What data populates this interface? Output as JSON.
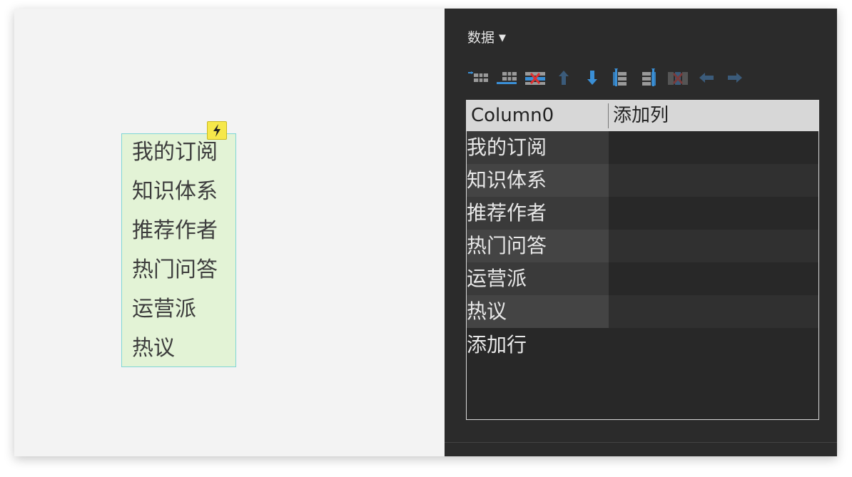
{
  "canvas": {
    "list_items": [
      "我的订阅",
      "知识体系",
      "推荐作者",
      "热门问答",
      "运营派",
      "热议"
    ],
    "badge_icon": "lightning-icon"
  },
  "panel": {
    "title": "数据",
    "title_arrow": "▼",
    "toolbar": [
      {
        "name": "insert-row-above-icon"
      },
      {
        "name": "insert-row-below-icon"
      },
      {
        "name": "delete-row-icon"
      },
      {
        "name": "move-up-icon"
      },
      {
        "name": "move-down-icon"
      },
      {
        "name": "insert-column-left-icon"
      },
      {
        "name": "insert-column-right-icon"
      },
      {
        "name": "delete-column-icon"
      },
      {
        "name": "move-left-icon"
      },
      {
        "name": "move-right-icon"
      }
    ],
    "grid": {
      "columns": [
        "Column0",
        "添加列"
      ],
      "rows": [
        "我的订阅",
        "知识体系",
        "推荐作者",
        "热门问答",
        "运营派",
        "热议"
      ],
      "add_row_label": "添加行"
    }
  },
  "colors": {
    "accent_blue": "#3a8fd6",
    "delete_red": "#e03030",
    "widget_fill": "#e3f3d6",
    "widget_border": "#7fd6d6",
    "panel_bg": "#2b2b2b"
  }
}
